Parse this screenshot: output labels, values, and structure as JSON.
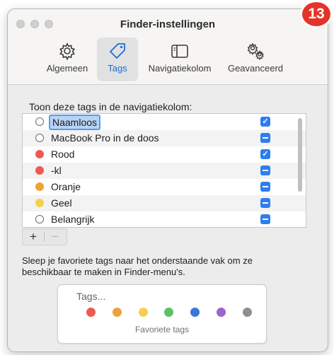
{
  "window": {
    "title": "Finder-instellingen",
    "tabs": [
      {
        "label": "Algemeen",
        "icon": "gear-icon",
        "active": false
      },
      {
        "label": "Tags",
        "icon": "tag-icon",
        "active": true
      },
      {
        "label": "Navigatiekolom",
        "icon": "sidebar-icon",
        "active": false
      },
      {
        "label": "Geavanceerd",
        "icon": "gears-icon",
        "active": false
      }
    ]
  },
  "badge": "13",
  "tags_section": {
    "heading": "Toon deze tags in de navigatiekolom:",
    "rows": [
      {
        "name": "Naamloos",
        "color": null,
        "checked": true,
        "selected": true
      },
      {
        "name": "MacBook Pro in de doos",
        "color": null,
        "checked": "mixed"
      },
      {
        "name": "Rood",
        "color": "#ec5a54",
        "checked": true
      },
      {
        "name": "-kl",
        "color": "#ec5a54",
        "checked": "mixed"
      },
      {
        "name": "Oranje",
        "color": "#f0a03c",
        "checked": "mixed"
      },
      {
        "name": "Geel",
        "color": "#f6cf4e",
        "checked": "mixed"
      },
      {
        "name": "Belangrijk",
        "color": null,
        "checked": "mixed"
      }
    ],
    "add_label": "+",
    "remove_label": "−"
  },
  "info_text": "Sleep je favoriete tags naar het onderstaande vak om ze beschikbaar te maken in Finder-menu's.",
  "favorites": {
    "heading": "Tags...",
    "label": "Favoriete tags",
    "colors": [
      "#ec5a54",
      "#f0a03c",
      "#f6cf4e",
      "#5cc163",
      "#3a78d6",
      "#9a65cf",
      "#8e8e8e"
    ]
  }
}
